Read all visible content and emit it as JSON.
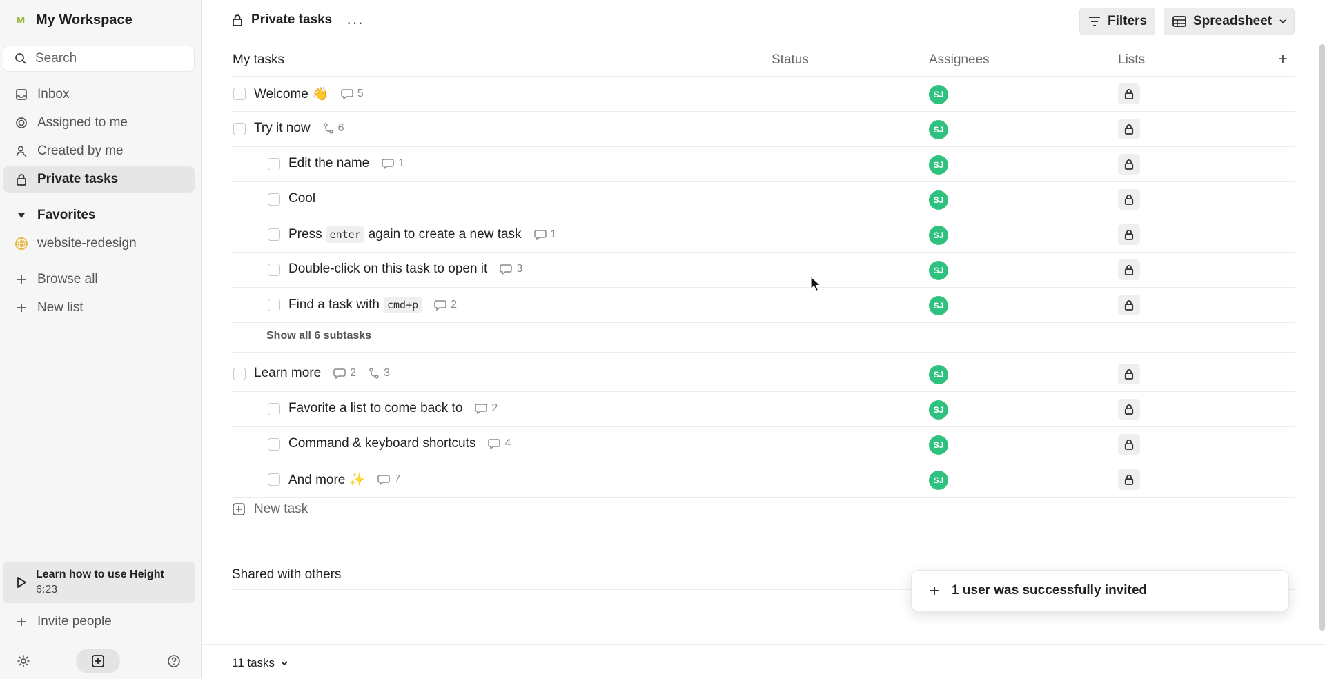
{
  "sidebar": {
    "workspace": {
      "badge": "M",
      "name": "My Workspace"
    },
    "search_placeholder": "Search",
    "nav": [
      {
        "label": "Inbox",
        "icon": "inbox-icon"
      },
      {
        "label": "Assigned to me",
        "icon": "target-icon"
      },
      {
        "label": "Created by me",
        "icon": "user-icon"
      },
      {
        "label": "Private tasks",
        "icon": "lock-icon"
      }
    ],
    "favorites_label": "Favorites",
    "favorites": [
      {
        "label": "website-redesign",
        "icon": "globe-icon"
      }
    ],
    "browse_all": "Browse all",
    "new_list": "New list",
    "learn": {
      "title": "Learn how to use Height",
      "duration": "6:23"
    },
    "invite": "Invite people"
  },
  "header": {
    "title": "Private tasks",
    "more": "···",
    "filters_label": "Filters",
    "view_label": "Spreadsheet"
  },
  "table": {
    "columns": [
      "My tasks",
      "Status",
      "Assignees",
      "Lists"
    ],
    "rows": [
      {
        "title": "Welcome 👋",
        "indent": 0,
        "comments": "5"
      },
      {
        "title": "Try it now",
        "indent": 0,
        "subtasks": "6"
      },
      {
        "title": "Edit the name",
        "indent": 1,
        "comments": "1"
      },
      {
        "title": "Cool",
        "indent": 1
      },
      {
        "title_parts": [
          "Press",
          "enter",
          "again to create a new task"
        ],
        "indent": 1,
        "comments": "1"
      },
      {
        "title": "Double-click on this task to open it",
        "indent": 1,
        "comments": "3"
      },
      {
        "title_parts": [
          "Find a task with",
          "cmd+p"
        ],
        "indent": 1,
        "comments": "2"
      },
      {
        "title": "Learn more",
        "indent": 0,
        "comments": "2",
        "subtasks": "3"
      },
      {
        "title": "Favorite a list to come back to",
        "indent": 1,
        "comments": "2"
      },
      {
        "title": "Command & keyboard shortcuts",
        "indent": 1,
        "comments": "4"
      },
      {
        "title": "And more ✨",
        "indent": 1,
        "comments": "7"
      }
    ],
    "assignee_initials": "SJ",
    "show_all_subtasks": "Show all 6 subtasks",
    "new_task": "New task"
  },
  "shared_section": "Shared with others",
  "toast": "1 user was successfully invited",
  "footer": {
    "count": "11 tasks"
  },
  "colors": {
    "accent_green": "#2ec27e",
    "workspace_badge": "#97b53a"
  }
}
